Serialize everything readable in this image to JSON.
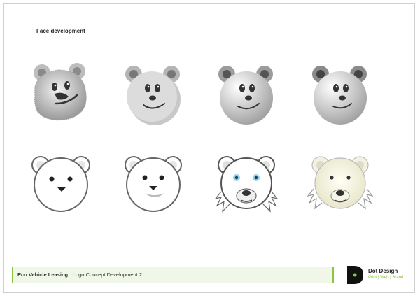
{
  "page": {
    "heading": "Face development"
  },
  "bears": [
    {
      "label": "bear-sketch-furry"
    },
    {
      "label": "bear-flat-grey"
    },
    {
      "label": "bear-gradient-grey"
    },
    {
      "label": "bear-gradient-grey-2"
    },
    {
      "label": "bear-outline-1"
    },
    {
      "label": "bear-outline-2"
    },
    {
      "label": "bear-outline-blue-eyes"
    },
    {
      "label": "bear-cream-fur"
    }
  ],
  "footer": {
    "client": "Eco Vehicle Leasing :",
    "project": "Logo Concept Development 2"
  },
  "brand": {
    "name": "Dot Design",
    "tagline": "Print | Web | Brand",
    "accent": "#8cc63f"
  }
}
